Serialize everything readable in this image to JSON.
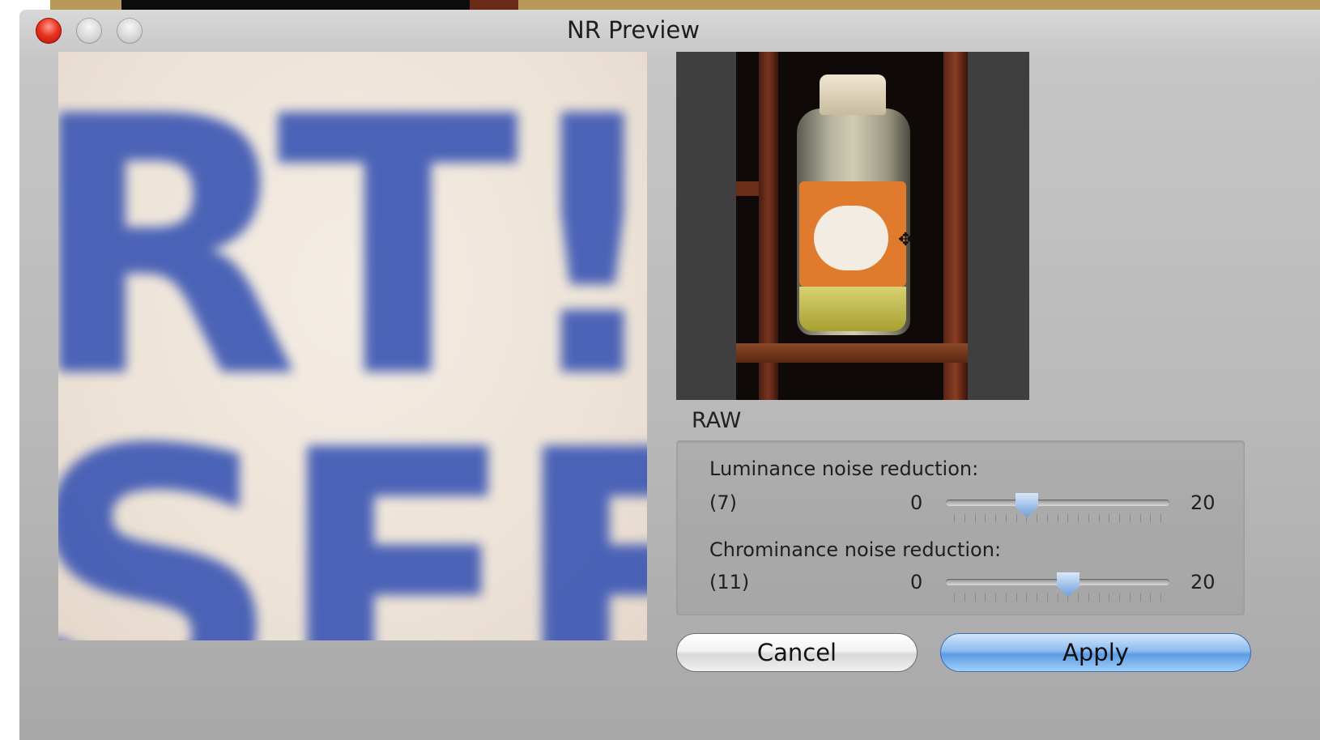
{
  "window": {
    "title": "NR Preview"
  },
  "zoom_preview": {
    "line1": "RT!S",
    "line2": "SEEI"
  },
  "navigator": {
    "crosshair": "✥"
  },
  "raw_section": {
    "label": "RAW"
  },
  "luminance": {
    "title": "Luminance noise reduction:",
    "value_text": "(7)",
    "min_label": "0",
    "max_label": "20",
    "value": 7,
    "min": 0,
    "max": 20
  },
  "chrominance": {
    "title": "Chrominance noise reduction:",
    "value_text": "(11)",
    "min_label": "0",
    "max_label": "20",
    "value": 11,
    "min": 0,
    "max": 20
  },
  "buttons": {
    "cancel": "Cancel",
    "apply": "Apply"
  },
  "colors": {
    "apply_button": "#5d9be4",
    "close_button": "#e8301f",
    "slider_knob": "#6f9ed8"
  }
}
